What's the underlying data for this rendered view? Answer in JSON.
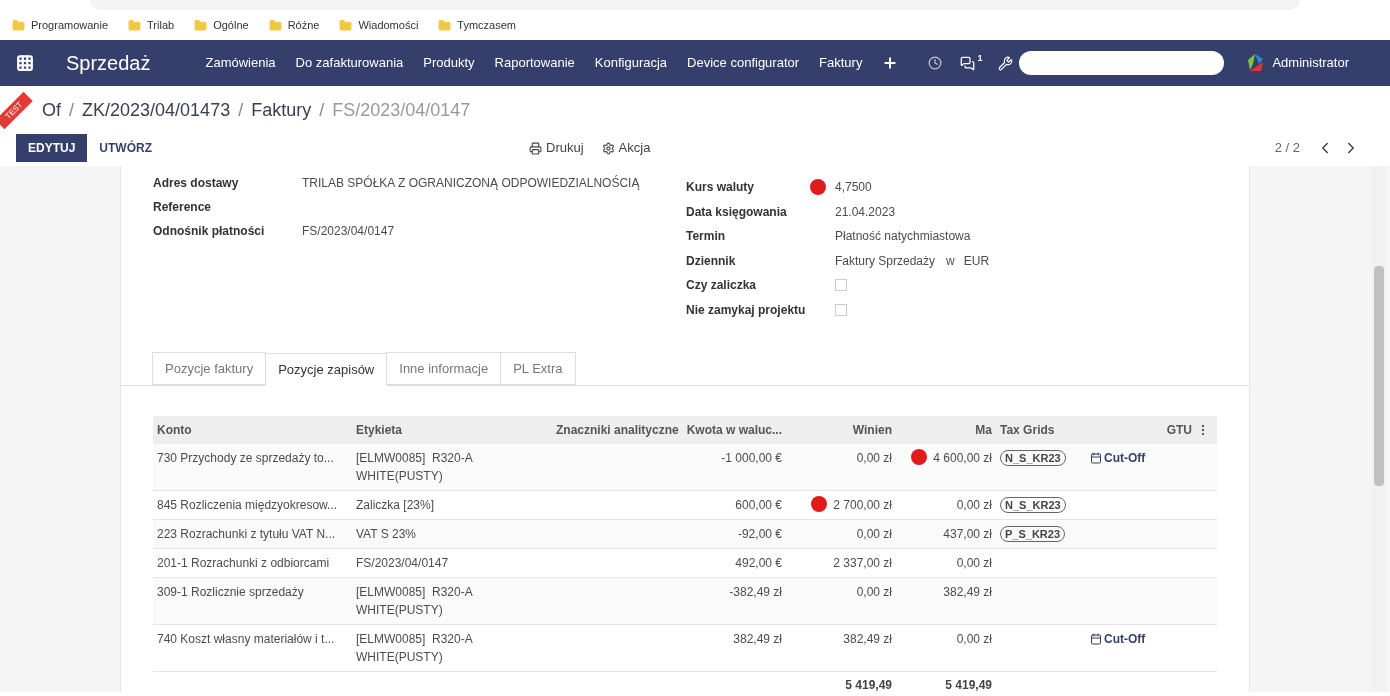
{
  "bookmarks": [
    "Programowanie",
    "Trilab",
    "Ogólne",
    "Różne",
    "Wiadomości",
    "Tymczasem"
  ],
  "navbar": {
    "app": "Sprzedaż",
    "menu": [
      "Zamówienia",
      "Do zafakturowania",
      "Produkty",
      "Raportowanie",
      "Konfiguracja",
      "Device configurator",
      "Faktury"
    ],
    "messages_count": "1",
    "user": "Administrator"
  },
  "ribbon": "TEST",
  "breadcrumb_separator": "/",
  "breadcrumb": [
    {
      "label": "Of",
      "current": false
    },
    {
      "label": "ZK/2023/04/01473",
      "current": false
    },
    {
      "label": "Faktury",
      "current": false
    },
    {
      "label": "FS/2023/04/0147",
      "current": true
    }
  ],
  "buttons": {
    "edit": "EDYTUJ",
    "create": "UTWÓRZ",
    "print": "Drukuj",
    "action": "Akcja"
  },
  "pager": "2 / 2",
  "left_fields": [
    {
      "label": "Adres dostawy",
      "value": "TRILAB SPÓŁKA Z OGRANICZONĄ ODPOWIEDZIALNOŚCIĄ"
    },
    {
      "label": "Reference"
    },
    {
      "label": "Odnośnik płatności",
      "value": "FS/2023/04/0147"
    }
  ],
  "right_fields": [
    {
      "kind": "text",
      "label": "Kurs waluty",
      "value": "4,7500",
      "flag": true
    },
    {
      "kind": "text",
      "label": "Data księgowania",
      "value": "21.04.2023",
      "flag": false
    },
    {
      "kind": "text",
      "label": "Termin",
      "value": "Płatność natychmiastowa",
      "flag": false
    },
    {
      "kind": "journal",
      "label": "Dziennik",
      "value": "Faktury Sprzedaży",
      "sep": "w",
      "currency": "EUR",
      "flag": false
    },
    {
      "kind": "checkbox",
      "label": "Czy zaliczka",
      "checked": false
    },
    {
      "kind": "checkbox",
      "label": "Nie zamykaj projektu",
      "checked": false
    }
  ],
  "tabs": [
    {
      "label": "Pozycje faktury",
      "selected": false
    },
    {
      "label": "Pozycje zapisów",
      "selected": true
    },
    {
      "label": "Inne informacje",
      "selected": false
    },
    {
      "label": "PL Extra",
      "selected": false
    }
  ],
  "table": {
    "columns": [
      "Konto",
      "Etykieta",
      "Znaczniki analityczne",
      "Kwota w waluc...",
      "Winien",
      "Ma",
      "Tax Grids",
      "GTU"
    ],
    "rows": [
      {
        "konto": "730 Przychody ze sprzedaży to...",
        "etykieta": [
          "[ELMW0085]  R320-A",
          "WHITE(PUSTY)"
        ],
        "kwota": "-1 000,00 €",
        "winien": "0,00 zł",
        "winien_flag": false,
        "ma": "4 600,00 zł",
        "ma_flag": true,
        "tax": "N_S_KR23",
        "cutoff": "Cut-Off"
      },
      {
        "konto": "845 Rozliczenia międzyokresow...",
        "etykieta": [
          "Zaliczka [23%]"
        ],
        "kwota": "600,00 €",
        "winien": "2 700,00 zł",
        "winien_flag": true,
        "ma": "0,00 zł",
        "ma_flag": false,
        "tax": "N_S_KR23"
      },
      {
        "konto": "223 Rozrachunki z tytułu VAT N...",
        "etykieta": [
          "VAT S 23%"
        ],
        "kwota": "-92,00 €",
        "winien": "0,00 zł",
        "winien_flag": false,
        "ma": "437,00 zł",
        "ma_flag": false,
        "tax": "P_S_KR23"
      },
      {
        "konto": "201-1 Rozrachunki z odbiorcami",
        "etykieta": [
          "FS/2023/04/0147"
        ],
        "kwota": "492,00 €",
        "winien": "2 337,00 zł",
        "winien_flag": false,
        "ma": "0,00 zł",
        "ma_flag": false
      },
      {
        "konto": "309-1 Rozlicznie sprzedaży",
        "etykieta": [
          "[ELMW0085]  R320-A",
          "WHITE(PUSTY)"
        ],
        "kwota": "-382,49 zł",
        "winien": "0,00 zł",
        "winien_flag": false,
        "ma": "382,49 zł",
        "ma_flag": false
      },
      {
        "konto": "740 Koszt własny materiałów i t...",
        "etykieta": [
          "[ELMW0085]  R320-A",
          "WHITE(PUSTY)"
        ],
        "kwota": "382,49 zł",
        "winien": "382,49 zł",
        "winien_flag": false,
        "ma": "0,00 zł",
        "ma_flag": false,
        "cutoff": "Cut-Off"
      }
    ],
    "totals": {
      "winien": "5 419,49",
      "ma": "5 419,49"
    }
  }
}
